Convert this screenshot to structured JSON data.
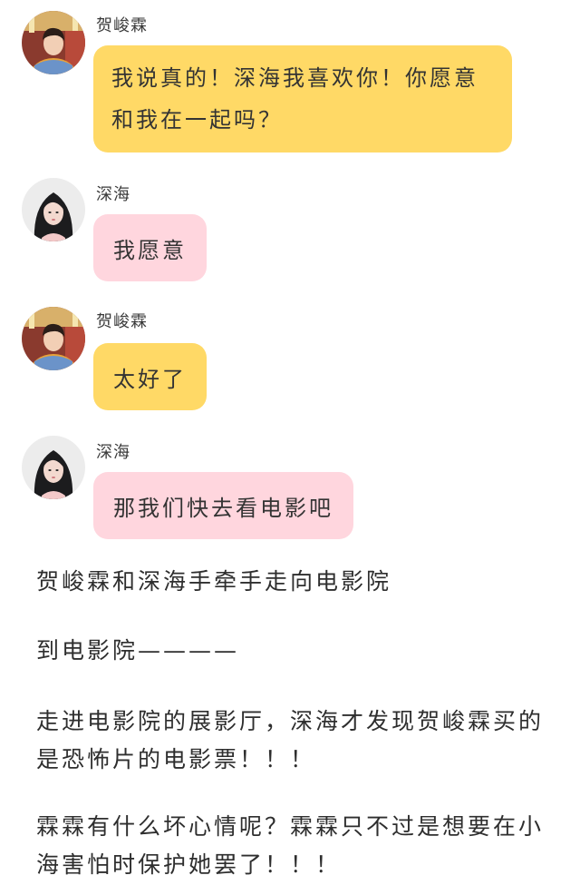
{
  "messages": [
    {
      "sender": "贺峻霖",
      "avatar_icon": "boy-avatar-icon",
      "bubble_color": "#ffd966",
      "text": "我说真的！深海我喜欢你！你愿意和我在一起吗？"
    },
    {
      "sender": "深海",
      "avatar_icon": "girl-avatar-icon",
      "bubble_color": "#ffd6de",
      "text": "我愿意"
    },
    {
      "sender": "贺峻霖",
      "avatar_icon": "boy-avatar-icon",
      "bubble_color": "#ffd966",
      "text": "太好了"
    },
    {
      "sender": "深海",
      "avatar_icon": "girl-avatar-icon",
      "bubble_color": "#ffd6de",
      "text": "那我们快去看电影吧"
    }
  ],
  "narration": [
    "贺峻霖和深海手牵手走向电影院",
    "到电影院————",
    "走进电影院的展影厅，深海才发现贺峻霖买的是恐怖片的电影票！！！",
    "霖霖有什么坏心情呢？霖霖只不过是想要在小海害怕时保护她罢了！！！"
  ]
}
